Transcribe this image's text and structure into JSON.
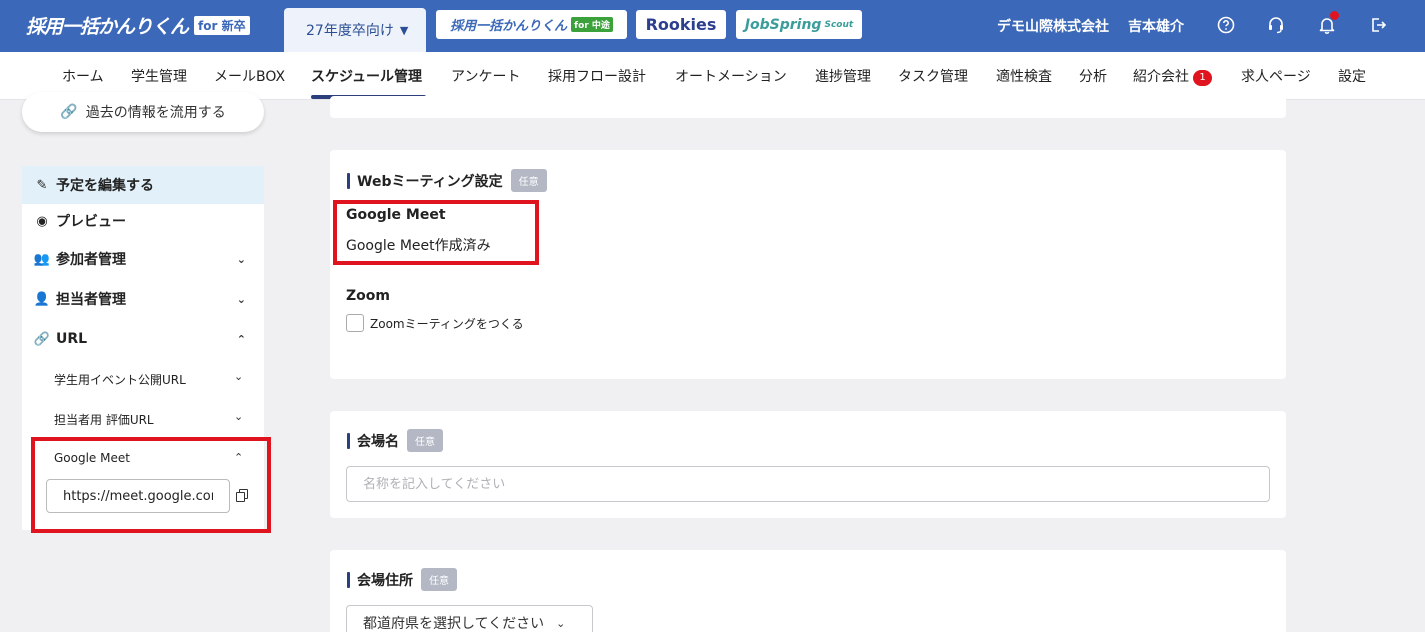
{
  "header": {
    "brand": "採用一括かんりくん",
    "brand_tag": "for 新卒",
    "year_select": "27年度卒向け",
    "logo_kanri_chuto": "採用一括かんりくん",
    "logo_kanri_chuto_tag": "for 中途",
    "logo_rookies": "Rookies",
    "logo_jobspring": "JobSpring",
    "logo_jobspring_tag": "Scout",
    "company": "デモ山際株式会社",
    "user": "吉本雄介"
  },
  "nav": {
    "items": [
      "ホーム",
      "学生管理",
      "メールBOX",
      "スケジュール管理",
      "アンケート",
      "採用フロー設計",
      "オートメーション",
      "進捗管理",
      "タスク管理",
      "適性検査",
      "分析",
      "紹介会社",
      "求人ページ",
      "設定"
    ],
    "badge": "1"
  },
  "sidebar": {
    "reuse_label": "過去の情報を流用する",
    "edit_label": "予定を編集する",
    "preview_label": "プレビュー",
    "participants_label": "参加者管理",
    "managers_label": "担当者管理",
    "url_label": "URL",
    "student_url_label": "学生用イベント公開URL",
    "evaluator_url_label": "担当者用 評価URL",
    "gmeet_label": "Google Meet",
    "gmeet_url": "https://meet.google.com"
  },
  "web_meeting": {
    "title": "Webミーティング設定",
    "tag": "任意",
    "gmeet_heading": "Google Meet",
    "gmeet_status": "Google Meet作成済み",
    "zoom_heading": "Zoom",
    "zoom_checkbox_label": "Zoomミーティングをつくる"
  },
  "venue": {
    "title": "会場名",
    "tag": "任意",
    "placeholder": "名称を記入してください"
  },
  "address": {
    "title": "会場住所",
    "tag": "任意",
    "prefecture_select": "都道府県を選択してください"
  },
  "colors": {
    "header_bg": "#3b68b8",
    "accent_navy": "#2b3f7d",
    "highlight_red": "#e0141e",
    "selected_bg": "#e2f0fa"
  }
}
